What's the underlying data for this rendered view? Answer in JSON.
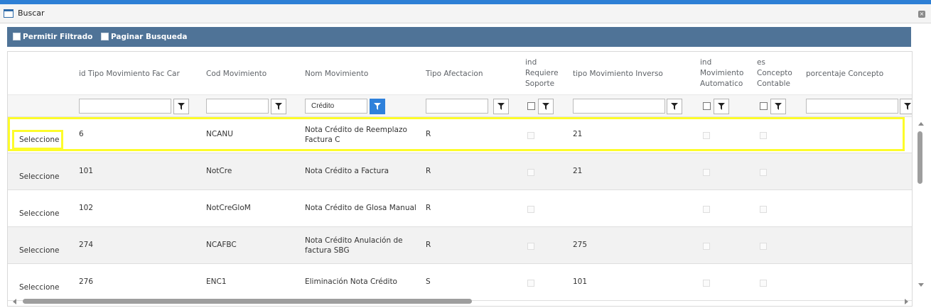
{
  "window": {
    "title": "Buscar"
  },
  "toolbar": {
    "allow_filter_label": "Permitir Filtrado",
    "paginate_label": "Paginar Busqueda"
  },
  "columns": {
    "id_tipo": "id Tipo Movimiento Fac Car",
    "cod": "Cod Movimiento",
    "nom": "Nom Movimiento",
    "tipo_afect": "Tipo Afectacion",
    "ind_req_line1": "ind",
    "ind_req_line2": "Requiere",
    "ind_req_line3": "Soporte",
    "tipo_inv": "tipo Movimiento Inverso",
    "ind_mov_line1": "ind",
    "ind_mov_line2": "Movimiento",
    "ind_mov_line3": "Automatico",
    "es_conc_line1": "es",
    "es_conc_line2": "Concepto",
    "es_conc_line3": "Contable",
    "porcentaje": "porcentaje Concepto"
  },
  "filters": {
    "nom_value": "Crédito"
  },
  "rows": [
    {
      "select": "Seleccione",
      "id": "6",
      "cod": "NCANU",
      "nom_line1": "Nota Crédito de Reemplazo",
      "nom_line2": "Factura C",
      "tipo_afect": "R",
      "tipo_inv": "21"
    },
    {
      "select": "Seleccione",
      "id": "101",
      "cod": "NotCre",
      "nom_line1": "Nota Crédito a Factura",
      "nom_line2": "",
      "tipo_afect": "R",
      "tipo_inv": "21"
    },
    {
      "select": "Seleccione",
      "id": "102",
      "cod": "NotCreGloM",
      "nom_line1": "Nota Crédito de Glosa Manual",
      "nom_line2": "",
      "tipo_afect": "R",
      "tipo_inv": ""
    },
    {
      "select": "Seleccione",
      "id": "274",
      "cod": "NCAFBC",
      "nom_line1": "Nota Crédito Anulación de",
      "nom_line2": "factura SBG",
      "tipo_afect": "R",
      "tipo_inv": "275"
    },
    {
      "select": "Seleccione",
      "id": "276",
      "cod": "ENC1",
      "nom_line1": "Eliminación Nota Crédito",
      "nom_line2": "",
      "tipo_afect": "S",
      "tipo_inv": "101"
    }
  ]
}
